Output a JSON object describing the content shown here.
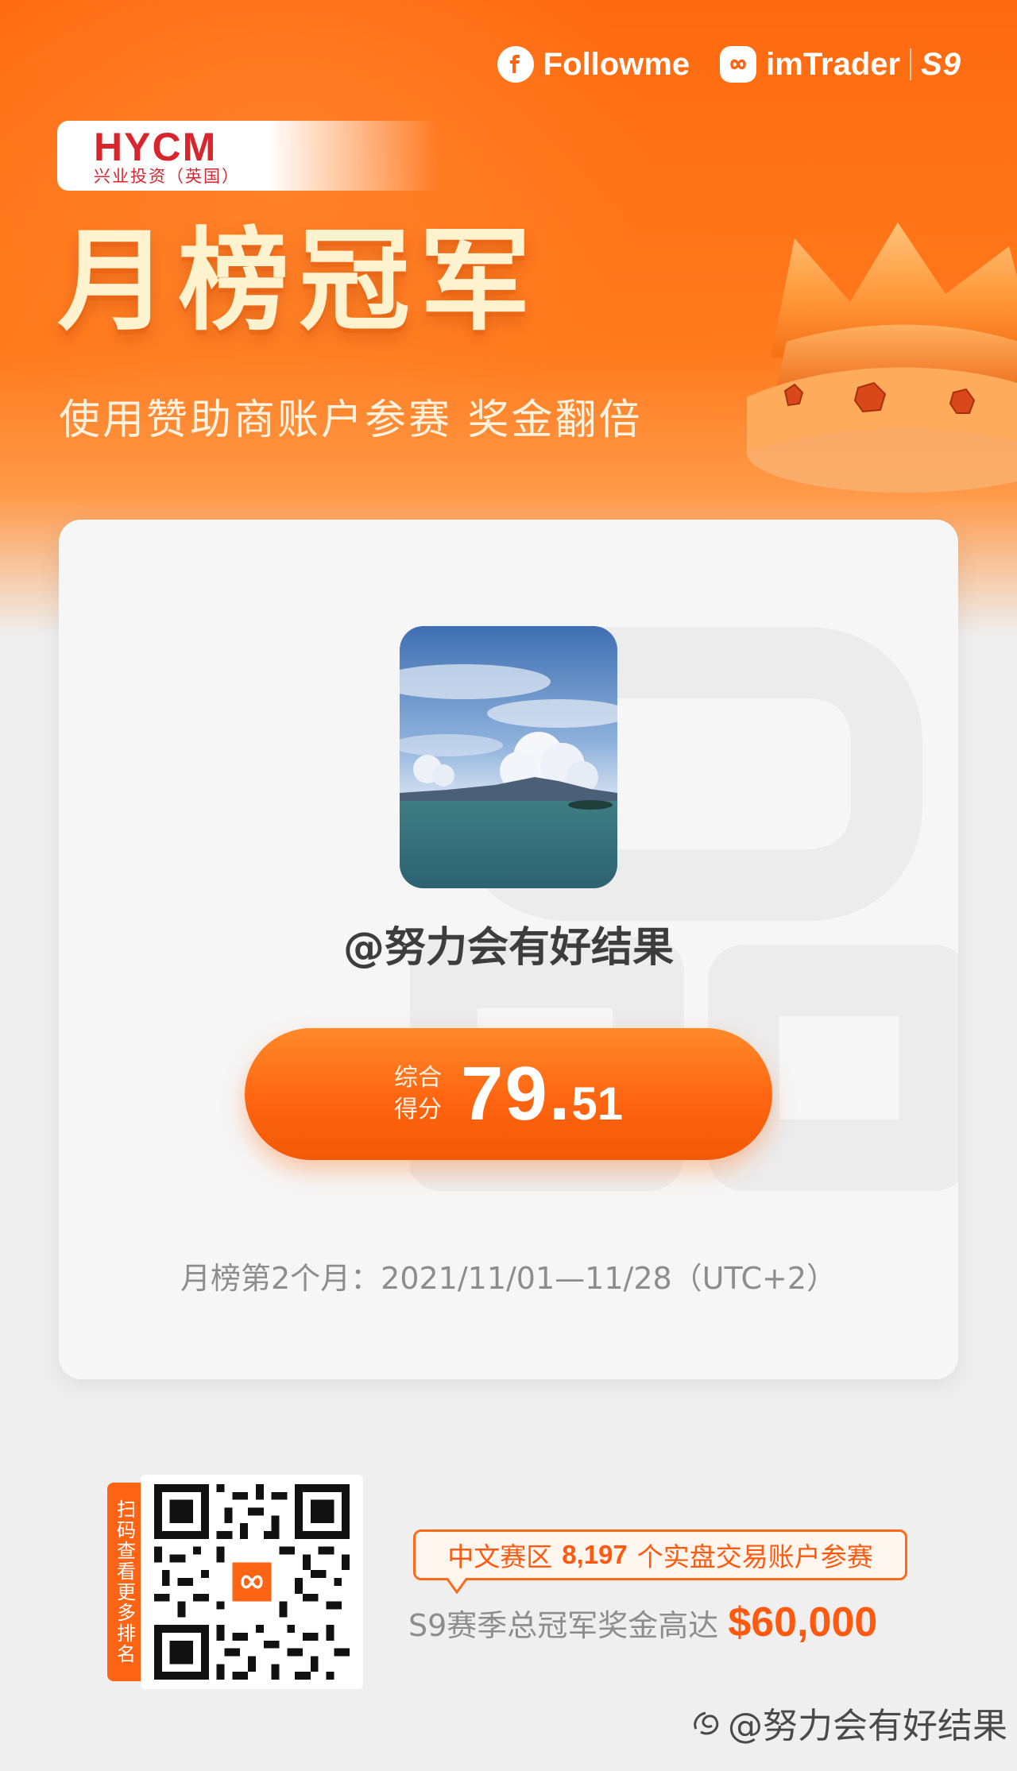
{
  "header": {
    "brand_followme": "Followme",
    "brand_imtrader": "imTrader",
    "season": "S9"
  },
  "sponsor": {
    "logo_text": "HYCM",
    "logo_subtext": "兴业投资（英国）"
  },
  "hero": {
    "title": "月榜冠军",
    "subtitle": "使用赞助商账户参赛 奖金翻倍"
  },
  "card": {
    "username": "@努力会有好结果",
    "score_label_line1": "综合",
    "score_label_line2": "得分",
    "score_int": "79.",
    "score_dec": "51",
    "period": "月榜第2个月：2021/11/01—11/28（UTC+2）"
  },
  "qr": {
    "tab_text": "扫码查看更多排名"
  },
  "promo": {
    "prefix": "中文赛区",
    "count": "8,197",
    "suffix": "个实盘交易账户参赛",
    "prize_text": "S9赛季总冠军奖金高达",
    "prize_amount": "$60,000"
  },
  "footer": {
    "watermark": "@努力会有好结果"
  },
  "colors": {
    "brand_orange": "#ff6414",
    "sponsor_red": "#d8262f",
    "text_gray": "#8d8d8d"
  }
}
